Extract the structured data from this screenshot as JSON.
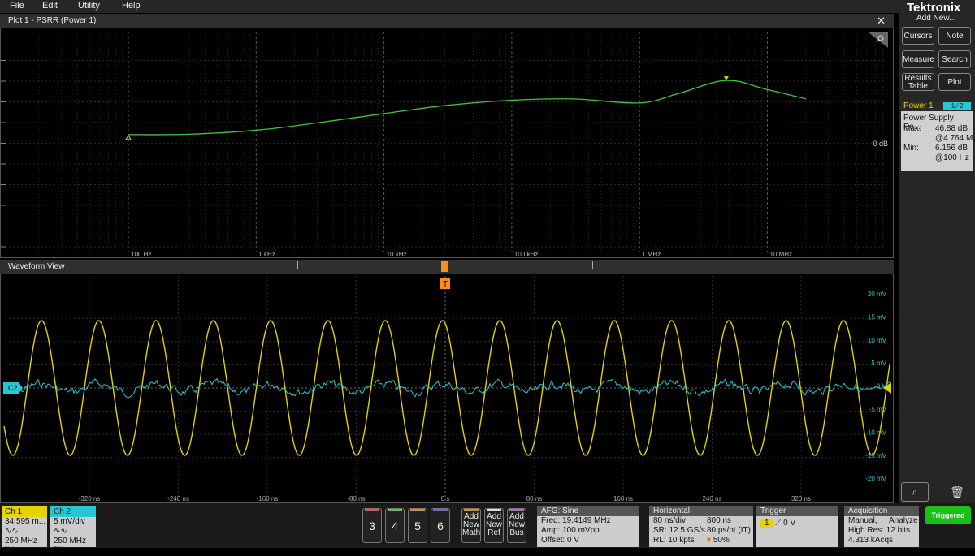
{
  "menu": [
    "File",
    "Edit",
    "Utility",
    "Help"
  ],
  "brand": "Tektronix",
  "plot_panel": {
    "title": "Plot 1 - PSRR (Power 1)",
    "zero_label": "0 dB",
    "x_ticks": [
      "100 Hz",
      "1 kHz",
      "10 kHz",
      "100 kHz",
      "1 MHz",
      "10 MHz"
    ]
  },
  "waveform_panel": {
    "title": "Waveform View",
    "ch2_marker": "C2",
    "trigger_marker": "T",
    "y_ticks": [
      "20 mV",
      "15 mV",
      "10 mV",
      "5 mV",
      "0 V",
      "-5 mV",
      "-10 mV",
      "-15 mV",
      "-20 mV"
    ],
    "x_ticks": [
      "-320 ns",
      "-240 ns",
      "-160 ns",
      "-80 ns",
      "0 s",
      "80 ns",
      "160 ns",
      "240 ns",
      "320 ns"
    ]
  },
  "right_panel": {
    "add_new": "Add New...",
    "buttons": [
      "Cursors",
      "Note",
      "Measure",
      "Search",
      "Results Table",
      "Plot"
    ],
    "measurement": {
      "name": "Power 1",
      "badge": "1 ⁄ 2",
      "label": "Power Supply Re...",
      "max_label": "Max:",
      "max_value": "46.88 dB",
      "max_freq": "@4.764 MHz",
      "min_label": "Min:",
      "min_value": "6.156 dB",
      "min_freq": "@100 Hz"
    }
  },
  "bottom": {
    "ch1": {
      "label": "Ch 1",
      "value": "34.595 m...",
      "bandwidth": "250 MHz",
      "color": "#e6d200"
    },
    "ch2": {
      "label": "Ch 2",
      "value": "5 mV/div",
      "bandwidth": "250 MHz",
      "color": "#25c8d2"
    },
    "channel_buttons": [
      {
        "label": "3",
        "color": "#e0564b"
      },
      {
        "label": "4",
        "color": "#5ec24d"
      },
      {
        "label": "5",
        "color": "#e08c2b"
      },
      {
        "label": "6",
        "color": "#6b63d6"
      }
    ],
    "add_buttons": [
      {
        "lines": [
          "Add",
          "New",
          "Math"
        ],
        "color": "#e08c2b"
      },
      {
        "lines": [
          "Add",
          "New",
          "Ref"
        ],
        "color": "#dddddd"
      },
      {
        "lines": [
          "Add",
          "New",
          "Bus"
        ],
        "color": "#a56ee0"
      }
    ],
    "afg": {
      "title": "AFG: Sine",
      "freq": "Freq: 19.4149 MHz",
      "amp": "Amp: 100 mVpp",
      "offset": "Offset: 0 V"
    },
    "horizontal": {
      "title": "Horizontal",
      "scale": "80 ns/div",
      "duration": "800 ns",
      "sr": "SR: 12.5 GS/s",
      "resolution": "80 ps/pt (IT)",
      "rl": "RL: 10 kpts",
      "position": "50%"
    },
    "trigger": {
      "title": "Trigger",
      "source": "1",
      "level": "0 V"
    },
    "acquisition": {
      "title": "Acquisition",
      "mode": "Manual,",
      "type": "Analyze",
      "res": "High Res: 12 bits",
      "count": "4.313 kAcqs"
    },
    "triggered": "Triggered"
  },
  "chart_data": {
    "type": "line",
    "title": "Plot 1 - PSRR (Power 1)",
    "x_scale": "log",
    "x": [
      100,
      300,
      1000,
      3000,
      10000,
      30000,
      100000,
      300000,
      1000000,
      2000000,
      4764000,
      10000000,
      20000000
    ],
    "series": [
      {
        "values": [
          6.156,
          6.5,
          9.5,
          15,
          22,
          28,
          32,
          33,
          30,
          37,
          46.88,
          40,
          33
        ]
      }
    ],
    "marker_max": {
      "x": 4764000,
      "y": 46.88
    },
    "marker_min": {
      "x": 100,
      "y": 6.156
    }
  },
  "colors": {
    "psrr": "#3cc83c",
    "ch1": "#e6d200",
    "ch2": "#25c8d2",
    "trigger": "#ff8c1a",
    "triggered_btn": "#18c018"
  }
}
